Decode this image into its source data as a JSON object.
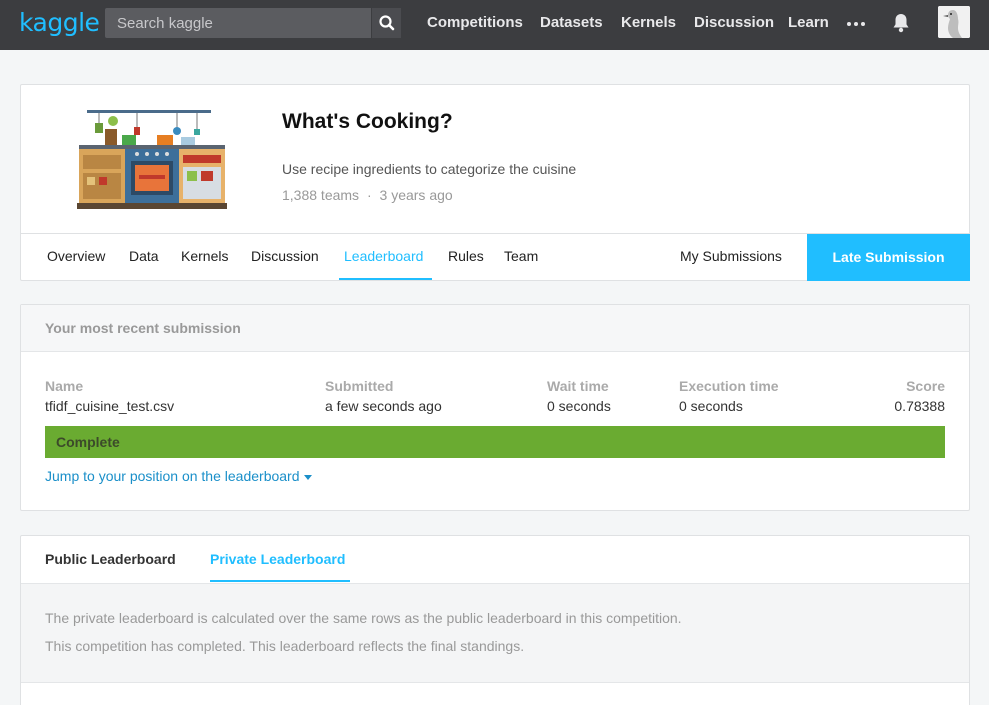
{
  "nav": {
    "logo": "kaggle",
    "search_placeholder": "Search kaggle",
    "links": [
      "Competitions",
      "Datasets",
      "Kernels",
      "Discussion",
      "Learn"
    ],
    "brand_color": "#20beff"
  },
  "competition": {
    "title": "What's Cooking?",
    "subtitle": "Use recipe ingredients to categorize the cuisine",
    "teams": "1,388 teams",
    "separator": "·",
    "age": "3 years ago",
    "tabs": [
      "Overview",
      "Data",
      "Kernels",
      "Discussion",
      "Leaderboard",
      "Rules",
      "Team"
    ],
    "active_tab": "Leaderboard",
    "my_submissions": "My Submissions",
    "late_submission": "Late Submission"
  },
  "submission": {
    "header": "Your most recent submission",
    "columns": {
      "name": {
        "label": "Name",
        "value": "tfidf_cuisine_test.csv"
      },
      "submitted": {
        "label": "Submitted",
        "value": "a few seconds ago"
      },
      "wait": {
        "label": "Wait time",
        "value": "0 seconds"
      },
      "execution": {
        "label": "Execution time",
        "value": "0 seconds"
      },
      "score": {
        "label": "Score",
        "value": "0.78388"
      }
    },
    "status": "Complete",
    "status_color": "#6aab31",
    "jump_link": "Jump to your position on the leaderboard"
  },
  "leaderboard": {
    "tabs": [
      "Public Leaderboard",
      "Private Leaderboard"
    ],
    "active_tab": "Private Leaderboard",
    "info_line1": "The private leaderboard is calculated over the same rows as the public leaderboard in this competition.",
    "info_line2": "This competition has completed. This leaderboard reflects the final standings."
  }
}
